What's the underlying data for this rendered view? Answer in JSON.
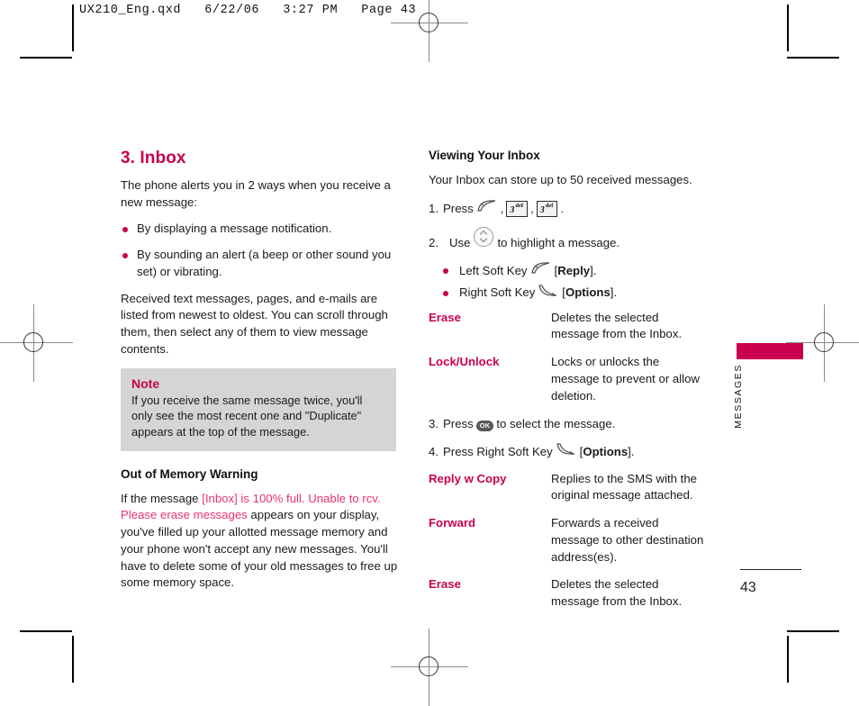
{
  "print_header": "UX210_Eng.qxd   6/22/06   3:27 PM   Page 43",
  "left_column": {
    "section_title": "3. Inbox",
    "intro": "The phone alerts you in 2 ways when you receive a new message:",
    "bullets": [
      "By displaying a message notification.",
      "By sounding an alert (a beep or other sound you set) or vibrating."
    ],
    "paragraph": "Received text messages, pages, and e-mails are listed from newest to oldest. You can scroll through them, then select any of them to view message contents.",
    "note": {
      "heading": "Note",
      "body": "If you receive the same message twice, you'll only see the most recent one and \"Duplicate\" appears at the top of the message."
    },
    "warning": {
      "heading": "Out of Memory Warning",
      "text_before": "If the message ",
      "text_highlight": "[Inbox] is 100% full. Unable to rcv. Please erase messages",
      "text_after": " appears on your display, you've filled up your allotted message memory and your phone won't accept any new messages. You'll have to delete some of your old messages to free up some memory space."
    }
  },
  "right_column": {
    "sub_title": "Viewing Your Inbox",
    "capacity_text": "Your Inbox can store up to 50 received messages.",
    "step1": {
      "number": "1.",
      "label": "Press",
      "comma1": ",",
      "comma2": ",",
      "period": "."
    },
    "keycap": {
      "digit": "3",
      "letters": "def"
    },
    "step2": {
      "number": "2.",
      "label": "Use",
      "tail": "to highlight a message."
    },
    "softkeys": [
      {
        "label": "Left Soft Key",
        "bracket_open": "[",
        "action": "Reply",
        "bracket_close": "]."
      },
      {
        "label": "Right Soft Key",
        "bracket_open": "[",
        "action": "Options",
        "bracket_close": "]."
      }
    ],
    "options_table_1": [
      {
        "term": "Erase",
        "desc": "Deletes the selected message from the Inbox."
      },
      {
        "term": "Lock/Unlock",
        "desc": "Locks or unlocks the message to prevent or allow deletion."
      }
    ],
    "step3": {
      "number": "3.",
      "label": "Press",
      "tail": "to select the message."
    },
    "step4": {
      "number": "4.",
      "label": "Press Right Soft Key",
      "bracket_open": "[",
      "action": "Options",
      "bracket_close": "]."
    },
    "options_table_2": [
      {
        "term": "Reply w Copy",
        "desc": "Replies to the SMS with the original message attached."
      },
      {
        "term": "Forward",
        "desc": "Forwards a received message to other destination address(es)."
      },
      {
        "term": "Erase",
        "desc": "Deletes the selected message from the Inbox."
      }
    ],
    "ok_key_label": "OK"
  },
  "side_tab": {
    "label": "MESSAGES"
  },
  "page_number": "43",
  "colors": {
    "accent_magenta": "#c8004f",
    "highlight_pink": "#e8336d",
    "note_background": "#d5d5d5"
  }
}
